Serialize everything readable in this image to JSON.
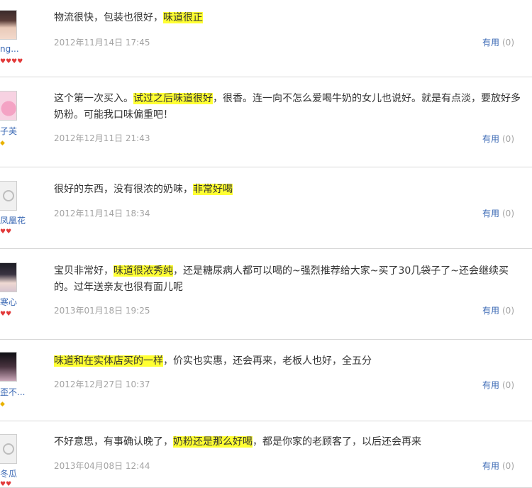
{
  "reviews": [
    {
      "user": "ng...",
      "rank_icons": "♥♥♥♥",
      "rank_color": "#e23a3a",
      "avatar": "photo-avatar",
      "text_before": "物流很快，包装也很好，",
      "highlight": "味道很正",
      "text_after": "",
      "date": "2012年11月14日 17:45",
      "helpful_label": "有用",
      "helpful_count": "(0)"
    },
    {
      "user": "子芙",
      "rank_icons": "◆",
      "rank_color": "#e8b100",
      "avatar": "pig-avatar",
      "text_before": "这个第一次买入。",
      "highlight": "试过之后味道很好",
      "text_after": "，很香。连一向不怎么爱喝牛奶的女儿也说好。就是有点淡，要放好多奶粉。可能我口味偏重吧！",
      "date": "2012年12月11日 21:43",
      "helpful_label": "有用",
      "helpful_count": "(0)"
    },
    {
      "user": "凤凰花",
      "rank_icons": "♥♥",
      "rank_color": "#e23a3a",
      "avatar": "default-avatar",
      "text_before": "很好的东西，没有很浓的奶味，",
      "highlight": "非常好喝",
      "text_after": "",
      "date": "2012年11月14日 18:34",
      "helpful_label": "有用",
      "helpful_count": "(0)"
    },
    {
      "user": "寒心",
      "rank_icons": "♥♥",
      "rank_color": "#e23a3a",
      "avatar": "girl-avatar",
      "text_before": "宝贝非常好，",
      "highlight": "味道很浓秀纯",
      "text_after": "，还是糖尿病人都可以喝的~强烈推荐给大家~买了30几袋子了~还会继续买的。过年送亲友也很有面儿呢",
      "date": "2013年01月18日 19:25",
      "helpful_label": "有用",
      "helpful_count": "(0)"
    },
    {
      "user": "歪不...",
      "rank_icons": "◆",
      "rank_color": "#e8b100",
      "avatar": "dark-avatar",
      "text_before": "",
      "highlight": "味道和在实体店买的一样",
      "text_after": "，价实也实惠，还会再来，老板人也好，全五分",
      "date": "2012年12月27日 10:37",
      "helpful_label": "有用",
      "helpful_count": "(0)"
    },
    {
      "user": "冬瓜",
      "rank_icons": "♥♥",
      "rank_color": "#e23a3a",
      "avatar": "default-avatar",
      "text_before": "不好意思，有事确认晚了，",
      "highlight": "奶粉还是那么好喝",
      "text_after": "，都是你家的老顾客了，以后还会再来",
      "date": "2013年04月08日 12:44",
      "helpful_label": "有用",
      "helpful_count": "(0)"
    }
  ]
}
